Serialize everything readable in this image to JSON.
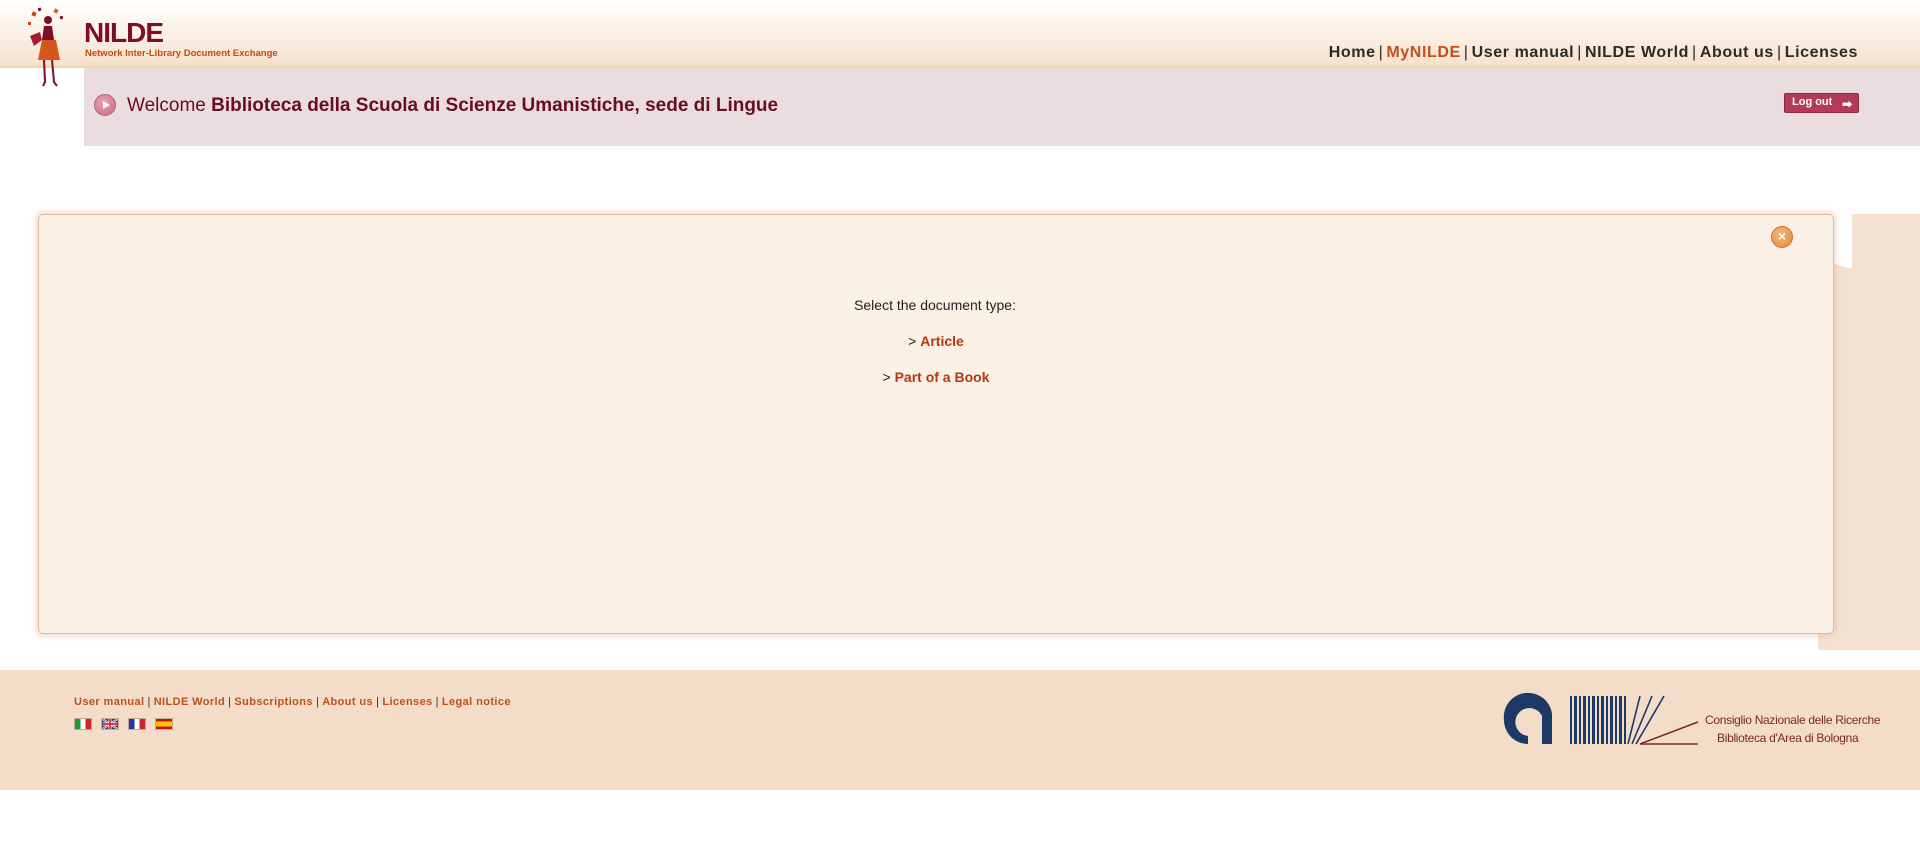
{
  "header": {
    "logo_title": "NILDE",
    "logo_subtitle": "Network Inter-Library Document Exchange",
    "nav": [
      {
        "label": "Home",
        "active": false
      },
      {
        "label": "MyNILDE",
        "active": true
      },
      {
        "label": "User manual",
        "active": false
      },
      {
        "label": "NILDE World",
        "active": false
      },
      {
        "label": "About us",
        "active": false
      },
      {
        "label": "Licenses",
        "active": false
      }
    ],
    "nav_separator": "|"
  },
  "welcome": {
    "prefix": "Welcome",
    "library_name": "Biblioteca della Scuola di Scienze Umanistiche, sede di Lingue",
    "logout_label": "Log out"
  },
  "main": {
    "close_icon": "×",
    "prompt": "Select the document type:",
    "option_marker": ">",
    "options": [
      {
        "label": "Article"
      },
      {
        "label": "Part of a Book"
      }
    ]
  },
  "footer": {
    "links": [
      "User manual",
      "NILDE World",
      "Subscriptions",
      "About us",
      "Licenses",
      "Legal notice"
    ],
    "languages": [
      {
        "code": "it",
        "icon": "italy-flag-icon"
      },
      {
        "code": "en",
        "icon": "uk-flag-icon"
      },
      {
        "code": "fr",
        "icon": "france-flag-icon"
      },
      {
        "code": "es",
        "icon": "spain-flag-icon"
      }
    ],
    "institution_line1": "Consiglio Nazionale delle Ricerche",
    "institution_line2": "Biblioteca d'Area di Bologna"
  },
  "colors": {
    "brand_dark_red": "#7d0f25",
    "accent_orange": "#c0501a",
    "welcome_bg": "#eadde0",
    "main_box_bg": "#faf0e6",
    "footer_bg": "#f3dcc8"
  }
}
